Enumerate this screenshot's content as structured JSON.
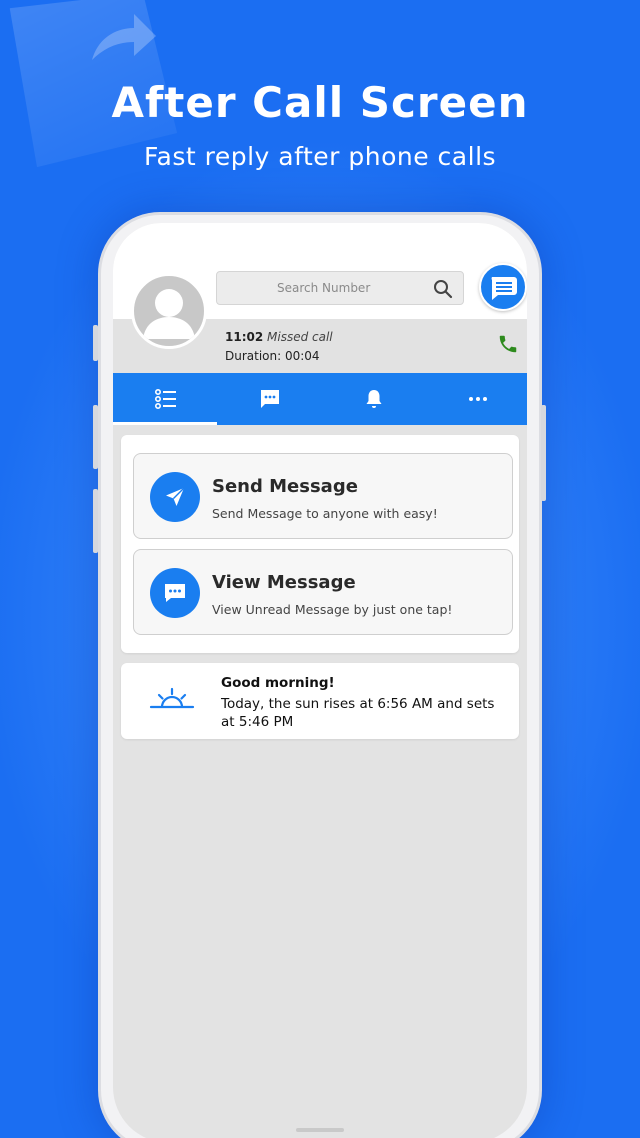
{
  "promo": {
    "title": "After Call Screen",
    "subtitle": "Fast reply after phone calls"
  },
  "header": {
    "search_placeholder": "Search Number",
    "call_time": "11:02",
    "call_status": "Missed call",
    "call_duration": "Duration: 00:04"
  },
  "tabs": [
    {
      "name": "list",
      "icon": "list-icon",
      "active": true
    },
    {
      "name": "messages",
      "icon": "message-icon",
      "active": false
    },
    {
      "name": "notifications",
      "icon": "bell-icon",
      "active": false
    },
    {
      "name": "more",
      "icon": "more-icon",
      "active": false
    }
  ],
  "actions": [
    {
      "title": "Send Message",
      "subtitle": "Send Message to anyone with easy!",
      "icon": "send-icon"
    },
    {
      "title": "View Message",
      "subtitle": "View Unread Message by just one tap!",
      "icon": "chat-icon"
    }
  ],
  "sun_card": {
    "title": "Good morning!",
    "text": "Today, the sun rises at 6:56 AM and sets at 5:46 PM",
    "icon": "sunrise-icon"
  },
  "colors": {
    "background": "#1b6ef2",
    "accent": "#1a7ef0",
    "call_green": "#2e8b1e"
  }
}
